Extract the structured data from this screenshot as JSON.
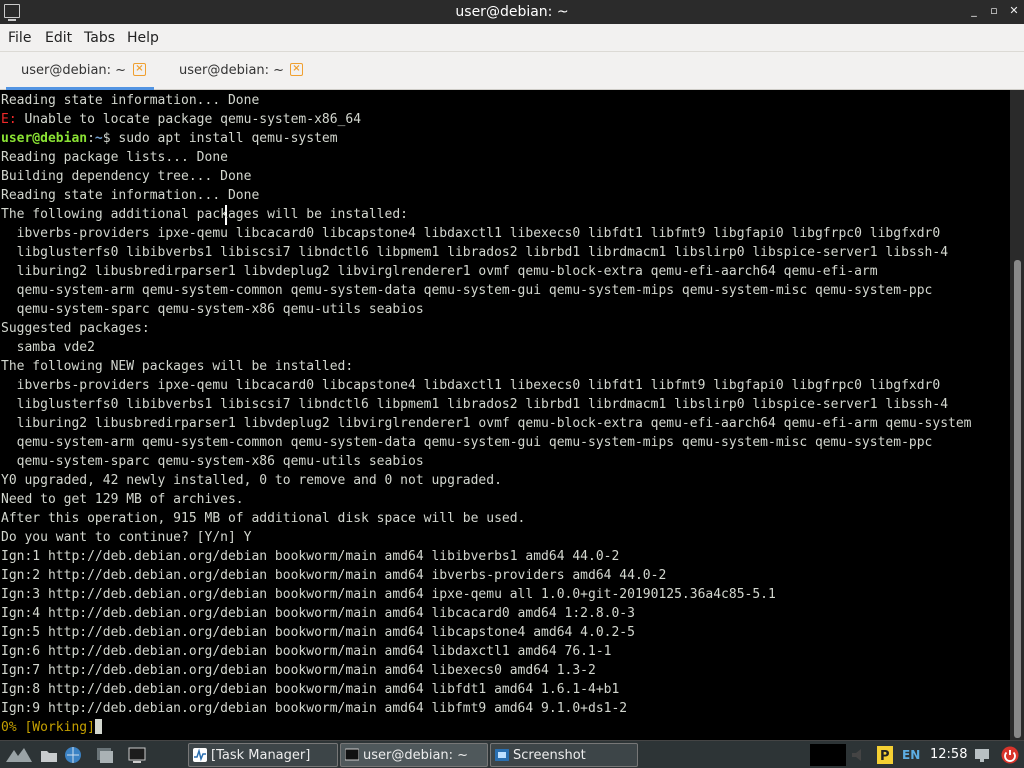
{
  "window": {
    "title": "user@debian: ~",
    "controls": {
      "minimize": "_",
      "maximize": "▫",
      "close": "✕"
    }
  },
  "menu": [
    "File",
    "Edit",
    "Tabs",
    "Help"
  ],
  "tabs": [
    {
      "label": "user@debian: ~",
      "active": true
    },
    {
      "label": "user@debian: ~",
      "active": false
    }
  ],
  "terminal": {
    "lines": [
      {
        "segments": [
          {
            "text": "Reading state information... Done"
          }
        ]
      },
      {
        "segments": [
          {
            "text": "E:",
            "style": "err"
          },
          {
            "text": " Unable to locate package qemu-system-x86_64"
          }
        ]
      },
      {
        "segments": [
          {
            "text": "user@debian",
            "style": "user"
          },
          {
            "text": ":",
            "style": "plain"
          },
          {
            "text": "~",
            "style": "path"
          },
          {
            "text": "$ sudo apt install qemu-system"
          }
        ]
      },
      {
        "segments": [
          {
            "text": "Reading package lists... Done"
          }
        ]
      },
      {
        "segments": [
          {
            "text": "Building dependency tree... Done"
          }
        ]
      },
      {
        "segments": [
          {
            "text": "Reading state information... Done"
          }
        ]
      },
      {
        "segments": [
          {
            "text": "The following additional packages will be installed:"
          }
        ]
      },
      {
        "segments": [
          {
            "text": "  ibverbs-providers ipxe-qemu libcacard0 libcapstone4 libdaxctl1 libexecs0 libfdt1 libfmt9 libgfapi0 libgfrpc0 libgfxdr0"
          }
        ]
      },
      {
        "segments": [
          {
            "text": "  libglusterfs0 libibverbs1 libiscsi7 libndctl6 libpmem1 librados2 librbd1 librdmacm1 libslirp0 libspice-server1 libssh-4"
          }
        ]
      },
      {
        "segments": [
          {
            "text": "  liburing2 libusbredirparser1 libvdeplug2 libvirglrenderer1 ovmf qemu-block-extra qemu-efi-aarch64 qemu-efi-arm"
          }
        ]
      },
      {
        "segments": [
          {
            "text": "  qemu-system-arm qemu-system-common qemu-system-data qemu-system-gui qemu-system-mips qemu-system-misc qemu-system-ppc"
          }
        ]
      },
      {
        "segments": [
          {
            "text": "  qemu-system-sparc qemu-system-x86 qemu-utils seabios"
          }
        ]
      },
      {
        "segments": [
          {
            "text": "Suggested packages:"
          }
        ]
      },
      {
        "segments": [
          {
            "text": "  samba vde2"
          }
        ]
      },
      {
        "segments": [
          {
            "text": "The following NEW packages will be installed:"
          }
        ]
      },
      {
        "segments": [
          {
            "text": "  ibverbs-providers ipxe-qemu libcacard0 libcapstone4 libdaxctl1 libexecs0 libfdt1 libfmt9 libgfapi0 libgfrpc0 libgfxdr0"
          }
        ]
      },
      {
        "segments": [
          {
            "text": "  libglusterfs0 libibverbs1 libiscsi7 libndctl6 libpmem1 librados2 librbd1 librdmacm1 libslirp0 libspice-server1 libssh-4"
          }
        ]
      },
      {
        "segments": [
          {
            "text": "  liburing2 libusbredirparser1 libvdeplug2 libvirglrenderer1 ovmf qemu-block-extra qemu-efi-aarch64 qemu-efi-arm qemu-system"
          }
        ]
      },
      {
        "segments": [
          {
            "text": "  qemu-system-arm qemu-system-common qemu-system-data qemu-system-gui qemu-system-mips qemu-system-misc qemu-system-ppc"
          }
        ]
      },
      {
        "segments": [
          {
            "text": "  qemu-system-sparc qemu-system-x86 qemu-utils seabios"
          }
        ]
      },
      {
        "segments": [
          {
            "text": "Y0 upgraded, 42 newly installed, 0 to remove and 0 not upgraded."
          }
        ]
      },
      {
        "segments": [
          {
            "text": "Need to get 129 MB of archives."
          }
        ]
      },
      {
        "segments": [
          {
            "text": "After this operation, 915 MB of additional disk space will be used."
          }
        ]
      },
      {
        "segments": [
          {
            "text": "Do you want to continue? [Y/n] Y"
          }
        ]
      },
      {
        "segments": [
          {
            "text": "Ign:1 http://deb.debian.org/debian bookworm/main amd64 libibverbs1 amd64 44.0-2"
          }
        ]
      },
      {
        "segments": [
          {
            "text": "Ign:2 http://deb.debian.org/debian bookworm/main amd64 ibverbs-providers amd64 44.0-2"
          }
        ]
      },
      {
        "segments": [
          {
            "text": "Ign:3 http://deb.debian.org/debian bookworm/main amd64 ipxe-qemu all 1.0.0+git-20190125.36a4c85-5.1"
          }
        ]
      },
      {
        "segments": [
          {
            "text": "Ign:4 http://deb.debian.org/debian bookworm/main amd64 libcacard0 amd64 1:2.8.0-3"
          }
        ]
      },
      {
        "segments": [
          {
            "text": "Ign:5 http://deb.debian.org/debian bookworm/main amd64 libcapstone4 amd64 4.0.2-5"
          }
        ]
      },
      {
        "segments": [
          {
            "text": "Ign:6 http://deb.debian.org/debian bookworm/main amd64 libdaxctl1 amd64 76.1-1"
          }
        ]
      },
      {
        "segments": [
          {
            "text": "Ign:7 http://deb.debian.org/debian bookworm/main amd64 libexecs0 amd64 1.3-2"
          }
        ]
      },
      {
        "segments": [
          {
            "text": "Ign:8 http://deb.debian.org/debian bookworm/main amd64 libfdt1 amd64 1.6.1-4+b1"
          }
        ]
      },
      {
        "segments": [
          {
            "text": "Ign:9 http://deb.debian.org/debian bookworm/main amd64 libfmt9 amd64 9.1.0+ds1-2"
          }
        ]
      },
      {
        "segments": [
          {
            "text": "0% [Working]",
            "style": "working"
          }
        ],
        "cursor": true
      }
    ]
  },
  "taskbar": {
    "tasks": [
      {
        "label": "[Task Manager]",
        "icon": "task-manager-icon",
        "active": false
      },
      {
        "label": "user@debian: ~",
        "icon": "terminal-icon",
        "active": true
      },
      {
        "label": "Screenshot",
        "icon": "screenshot-icon",
        "active": false
      }
    ],
    "language": "EN",
    "clock": "12:58"
  },
  "colors": {
    "terminal_bg": "#000000",
    "terminal_fg": "#d3d7cf",
    "error": "#ef2929",
    "prompt_user": "#8ae234",
    "prompt_path": "#729fcf",
    "working": "#c4a000",
    "tab_accent": "#5294e2",
    "tab_close": "#f0a030"
  }
}
